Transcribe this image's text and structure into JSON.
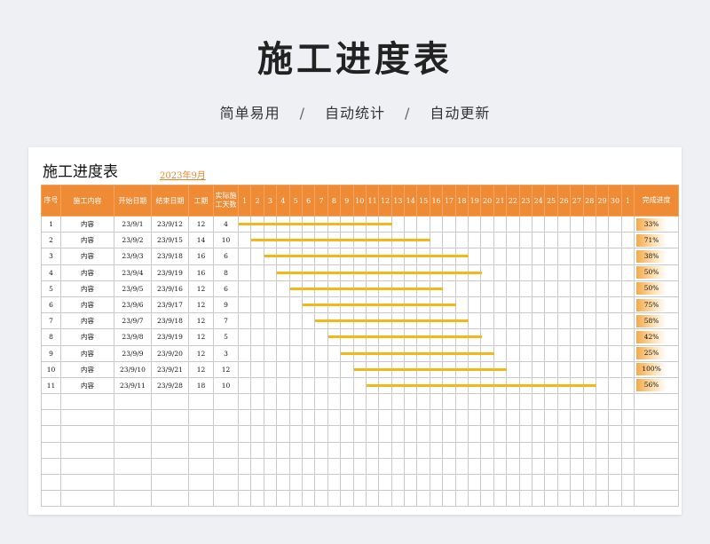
{
  "header": {
    "title": "施工进度表",
    "features": [
      "简单易用",
      "自动统计",
      "自动更新"
    ],
    "separator": "/"
  },
  "sheet": {
    "title": "施工进度表",
    "month": "2023年9月",
    "columns": {
      "index": "序号",
      "content": "施工内容",
      "start": "开始日期",
      "end": "结束日期",
      "duration": "工期",
      "actual": "实际施工天数",
      "completion": "完成进度"
    },
    "days": [
      "1",
      "2",
      "3",
      "4",
      "5",
      "6",
      "7",
      "8",
      "9",
      "10",
      "11",
      "12",
      "13",
      "14",
      "15",
      "16",
      "17",
      "18",
      "19",
      "20",
      "21",
      "22",
      "23",
      "24",
      "25",
      "26",
      "27",
      "28",
      "29",
      "30",
      "1"
    ],
    "rows": [
      {
        "no": "1",
        "content": "内容",
        "start": "23/9/1",
        "end": "23/9/12",
        "duration": "12",
        "actual": "4",
        "pct": "33%",
        "pct_value": 0.33,
        "bar_start_day": 1,
        "bar_end_day": 12
      },
      {
        "no": "2",
        "content": "内容",
        "start": "23/9/2",
        "end": "23/9/15",
        "duration": "14",
        "actual": "10",
        "pct": "71%",
        "pct_value": 0.71,
        "bar_start_day": 2,
        "bar_end_day": 15
      },
      {
        "no": "3",
        "content": "内容",
        "start": "23/9/3",
        "end": "23/9/18",
        "duration": "16",
        "actual": "6",
        "pct": "38%",
        "pct_value": 0.38,
        "bar_start_day": 3,
        "bar_end_day": 18
      },
      {
        "no": "4",
        "content": "内容",
        "start": "23/9/4",
        "end": "23/9/19",
        "duration": "16",
        "actual": "8",
        "pct": "50%",
        "pct_value": 0.5,
        "bar_start_day": 4,
        "bar_end_day": 19
      },
      {
        "no": "5",
        "content": "内容",
        "start": "23/9/5",
        "end": "23/9/16",
        "duration": "12",
        "actual": "6",
        "pct": "50%",
        "pct_value": 0.5,
        "bar_start_day": 5,
        "bar_end_day": 16
      },
      {
        "no": "6",
        "content": "内容",
        "start": "23/9/6",
        "end": "23/9/17",
        "duration": "12",
        "actual": "9",
        "pct": "75%",
        "pct_value": 0.75,
        "bar_start_day": 6,
        "bar_end_day": 17
      },
      {
        "no": "7",
        "content": "内容",
        "start": "23/9/7",
        "end": "23/9/18",
        "duration": "12",
        "actual": "7",
        "pct": "58%",
        "pct_value": 0.58,
        "bar_start_day": 7,
        "bar_end_day": 18
      },
      {
        "no": "8",
        "content": "内容",
        "start": "23/9/8",
        "end": "23/9/19",
        "duration": "12",
        "actual": "5",
        "pct": "42%",
        "pct_value": 0.42,
        "bar_start_day": 8,
        "bar_end_day": 19
      },
      {
        "no": "9",
        "content": "内容",
        "start": "23/9/9",
        "end": "23/9/20",
        "duration": "12",
        "actual": "3",
        "pct": "25%",
        "pct_value": 0.25,
        "bar_start_day": 9,
        "bar_end_day": 20
      },
      {
        "no": "10",
        "content": "内容",
        "start": "23/9/10",
        "end": "23/9/21",
        "duration": "12",
        "actual": "12",
        "pct": "100%",
        "pct_value": 1.0,
        "bar_start_day": 10,
        "bar_end_day": 21
      },
      {
        "no": "11",
        "content": "内容",
        "start": "23/9/11",
        "end": "23/9/28",
        "duration": "18",
        "actual": "10",
        "pct": "56%",
        "pct_value": 0.56,
        "bar_start_day": 11,
        "bar_end_day": 28
      }
    ],
    "empty_rows": 7
  },
  "colors": {
    "header_bg": "#ef8b34",
    "bar": "#f2b817",
    "month_link": "#e6862b"
  }
}
